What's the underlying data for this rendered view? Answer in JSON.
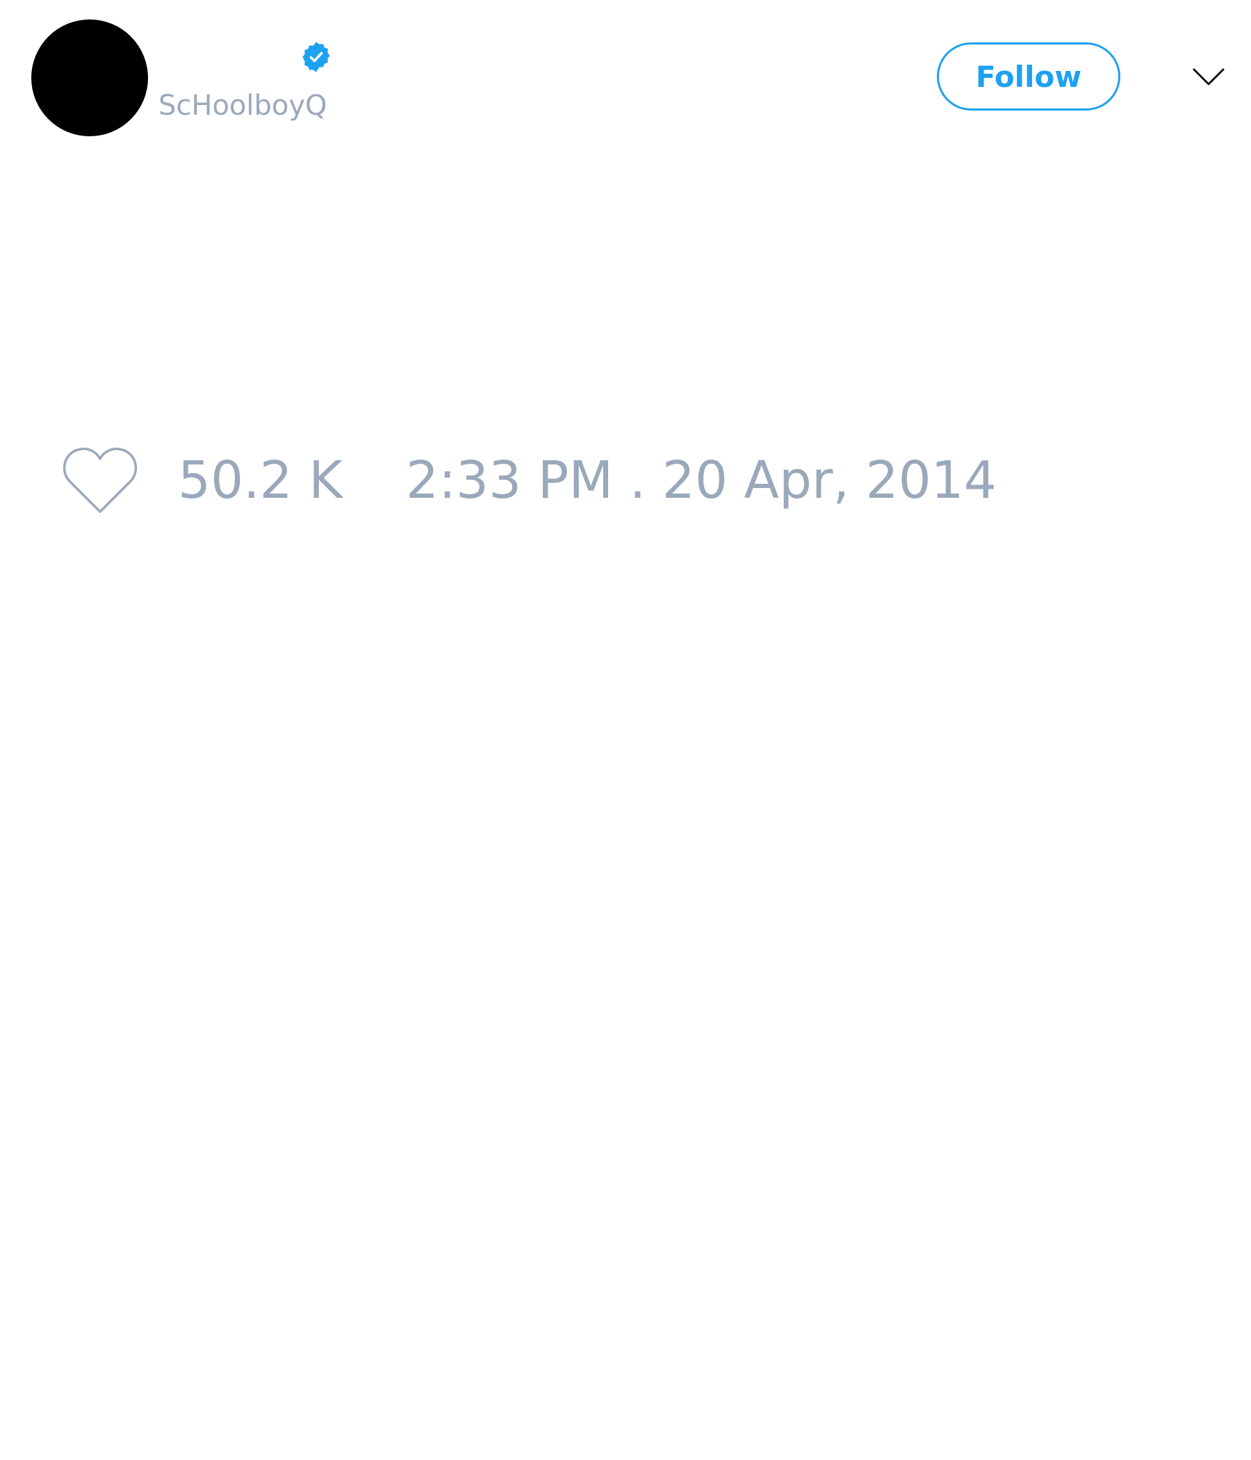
{
  "colors": {
    "accent": "#1da1f2",
    "muted_text": "#9aa8bb",
    "avatar": "#000000",
    "background": "#ffffff"
  },
  "tweet": {
    "author": {
      "handle": "ScHoolboyQ",
      "verified": true,
      "verified_icon": "verified-badge-icon"
    },
    "follow_label": "Follow",
    "menu_icon": "chevron-down-icon",
    "like_icon": "heart-outline-icon",
    "likes": "50.2 K",
    "timestamp": "2:33 PM . 20 Apr, 2014"
  }
}
